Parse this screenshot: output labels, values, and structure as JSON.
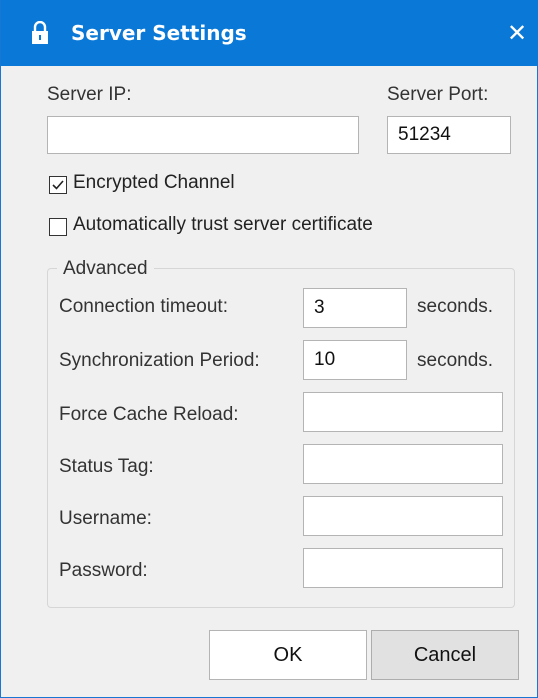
{
  "window": {
    "title": "Server Settings",
    "close_glyph": "✕",
    "title_icon": "lock-icon"
  },
  "server": {
    "ip_label": "Server IP:",
    "ip_value": "",
    "port_label": "Server Port:",
    "port_value": "51234"
  },
  "options": {
    "encrypted_label": "Encrypted Channel",
    "encrypted_checked": true,
    "trust_label": "Automatically trust server certificate",
    "trust_checked": false
  },
  "advanced": {
    "group_label": "Advanced",
    "timeout_label": "Connection timeout:",
    "timeout_value": "3",
    "timeout_unit": "seconds.",
    "sync_label": "Synchronization Period:",
    "sync_value": "10",
    "sync_unit": "seconds.",
    "cache_label": "Force Cache Reload:",
    "cache_value": "",
    "status_label": "Status Tag:",
    "status_value": "",
    "username_label": "Username:",
    "username_value": "",
    "password_label": "Password:",
    "password_value": ""
  },
  "buttons": {
    "ok": "OK",
    "cancel": "Cancel"
  },
  "colors": {
    "titlebar": "#0a78d7",
    "dialog_bg": "#f0f0f0"
  }
}
